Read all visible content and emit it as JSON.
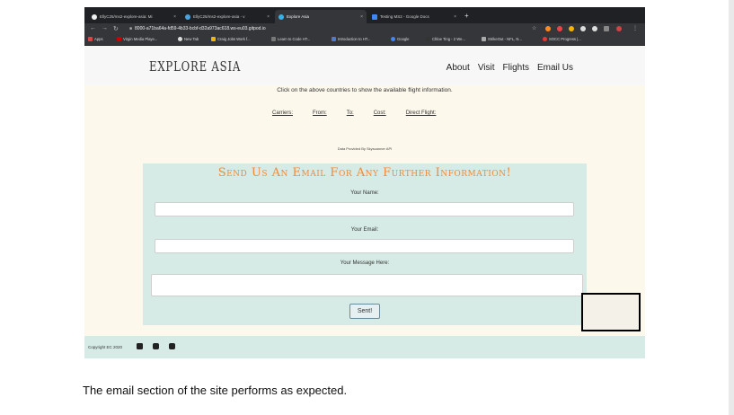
{
  "browser": {
    "tabs": [
      {
        "label": "EllyC25/ms2-explore-asia: Mi",
        "active": false
      },
      {
        "label": "EllyC25/ms2-explore-asia - v",
        "active": false
      },
      {
        "label": "Explore Asia",
        "active": true
      },
      {
        "label": "Testing MS2 - Google Docs",
        "active": false
      }
    ],
    "new_tab": "+",
    "url": "8000-a71ba64a-fd59-4b33-bcbf-d32a973ac618.ws-eu03.gitpod.io",
    "bookmarks": [
      "Apps",
      "Virgin Media Playe...",
      "New Tab",
      "Craig Jobs Work f...",
      "Learn to Code HT...",
      "Introduction to HT...",
      "Google",
      "Chloe Ting - 2 We...",
      "StrikeOut - NFL, N...",
      "SOCC Progress |..."
    ]
  },
  "site": {
    "brand": "Explore Asia",
    "nav": [
      "About",
      "Visit",
      "Flights",
      "Email Us"
    ],
    "hint": "Click on the above countries to show the available flight information.",
    "filters": [
      "Carriers:",
      "From:",
      "To:",
      "Cost:",
      "Direct Flight:"
    ],
    "credit": "Data Provided By Skyscanner API",
    "email": {
      "title": "Send Us An Email For Any Further Information!",
      "name_label": "Your Name:",
      "email_label": "Your Email:",
      "message_label": "Your Message Here:",
      "send_label": "Sent!"
    },
    "footer": {
      "copyright": "Copyright EC 2020"
    }
  },
  "caption": "The email section of the site performs as expected.",
  "colors": {
    "title_accent": "#f08a3a",
    "panel_bg": "#d6ebe5",
    "page_bg": "#fdf8ec"
  }
}
